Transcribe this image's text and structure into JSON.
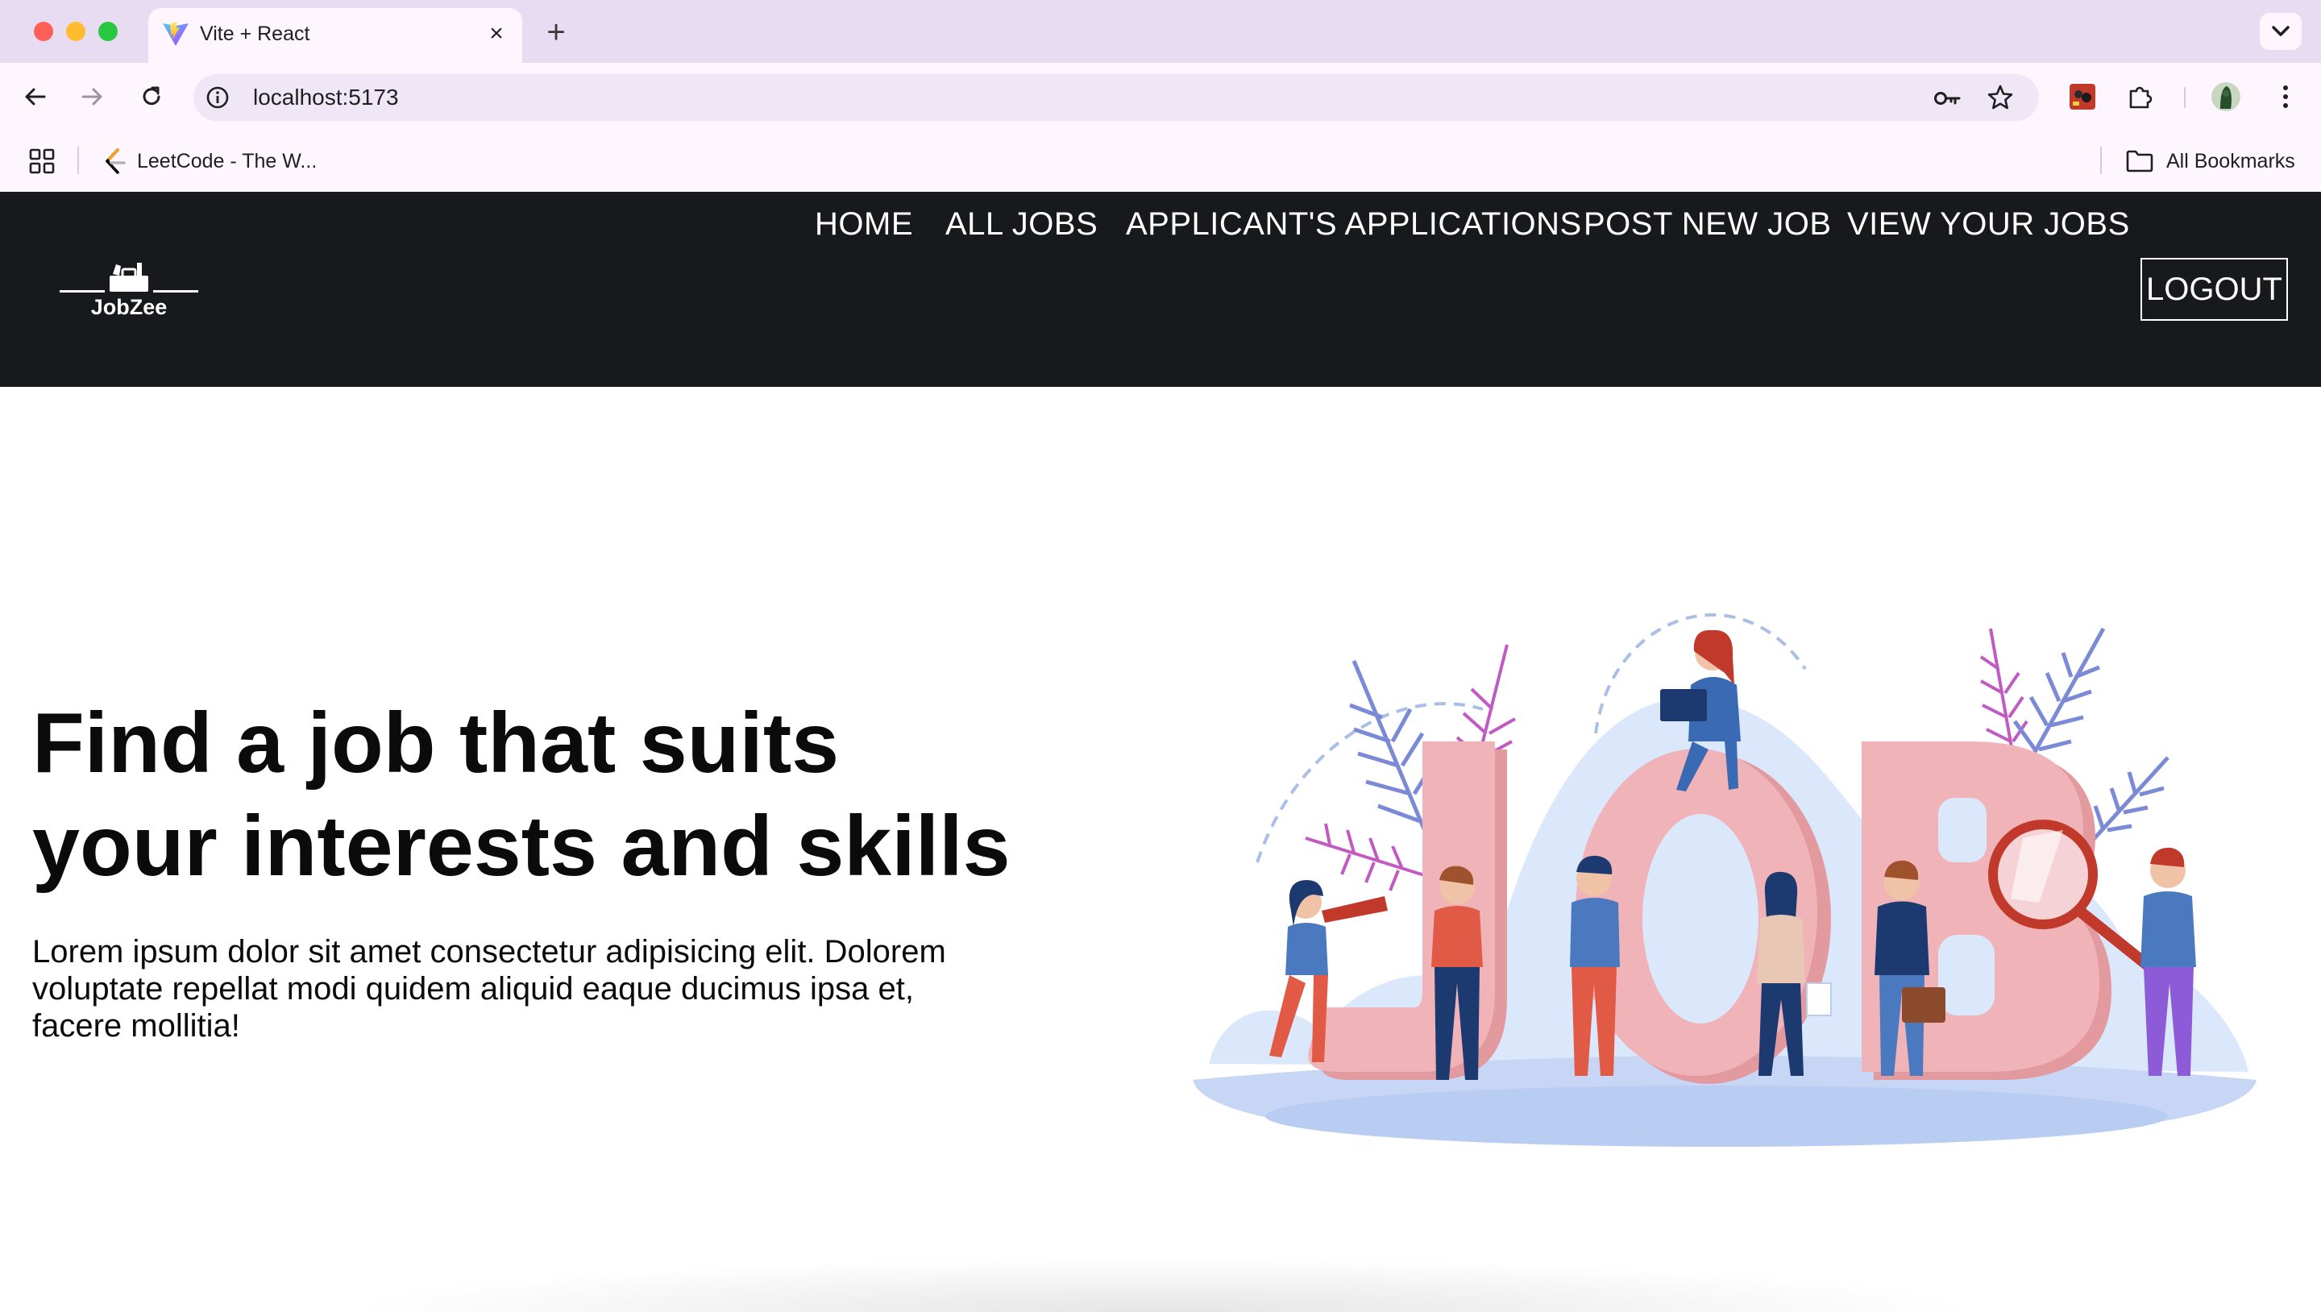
{
  "browser": {
    "tab": {
      "title": "Vite + React",
      "close_icon": "close-icon",
      "favicon": "vite-logo-icon"
    },
    "new_tab_label": "+",
    "address": {
      "url": "localhost:5173"
    },
    "bookmarks": {
      "items": [
        {
          "label": "LeetCode - The W...",
          "icon": "leetcode-icon"
        }
      ],
      "all_label": "All Bookmarks"
    }
  },
  "site": {
    "logo_text": "JobZee",
    "nav": {
      "home": "HOME",
      "all_jobs": "ALL JOBS",
      "applications": "APPLICANT'S APPLICATIONS",
      "post_job": "POST NEW JOB",
      "view_jobs": "VIEW YOUR JOBS",
      "logout": "LOGOUT"
    },
    "hero": {
      "title_line1": "Find a job that suits",
      "title_line2": "your interests and skills",
      "text": "Lorem ipsum dolor sit amet consectetur adipisicing elit. Dolorem voluptate repellat modi quidem aliquid eaque ducimus ipsa et, facere mollitia!"
    },
    "colors": {
      "navbar_bg": "#18191c",
      "accent_pink": "#f0b4b8"
    }
  }
}
